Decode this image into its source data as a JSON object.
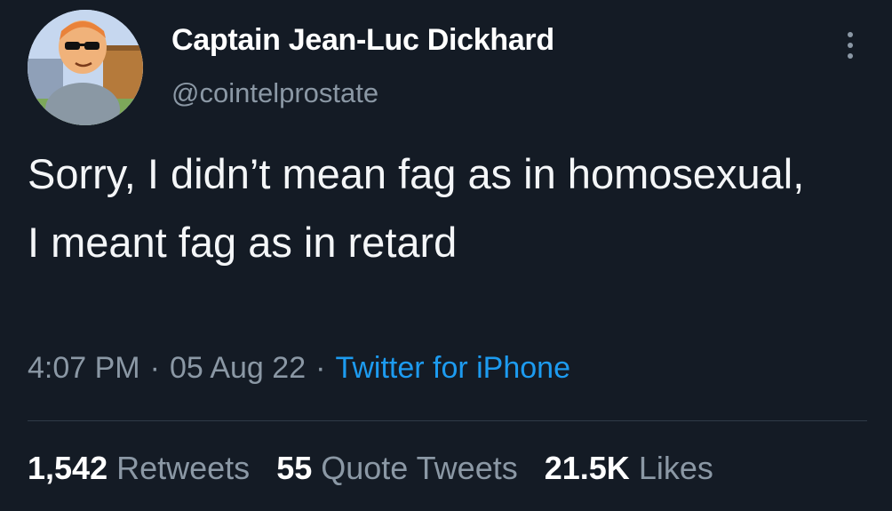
{
  "user": {
    "display_name": "Captain Jean-Luc Dickhard",
    "handle": "@cointelprostate"
  },
  "tweet": {
    "text": "Sorry, I didn’t mean fag as in homosexual, I meant fag as in retard"
  },
  "meta": {
    "time": "4:07 PM",
    "date": "05 Aug 22",
    "separator": "·",
    "source": "Twitter for iPhone"
  },
  "stats": {
    "retweets_count": "1,542",
    "retweets_label": "Retweets",
    "quotes_count": "55",
    "quotes_label": "Quote Tweets",
    "likes_count": "21.5K",
    "likes_label": "Likes"
  },
  "colors": {
    "background": "#141b25",
    "text_secondary": "#8b98a5",
    "link": "#1d9bf0"
  },
  "icons": {
    "more": "more-vertical-icon"
  }
}
